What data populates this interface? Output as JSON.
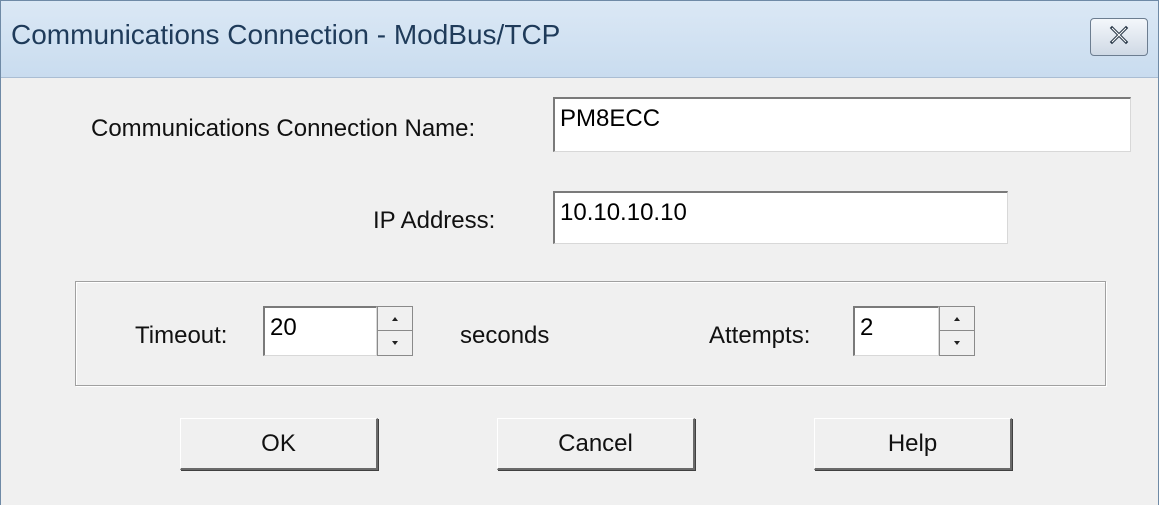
{
  "window": {
    "title": "Communications Connection - ModBus/TCP",
    "close_icon": "close-x-icon"
  },
  "form": {
    "name_label": "Communications Connection Name:",
    "name_value": "PM8ECC",
    "ip_label": "IP Address:",
    "ip_value": "10.10.10.10"
  },
  "settings": {
    "timeout_label": "Timeout:",
    "timeout_value": "20",
    "timeout_unit": "seconds",
    "attempts_label": "Attempts:",
    "attempts_value": "2"
  },
  "buttons": {
    "ok": "OK",
    "cancel": "Cancel",
    "help": "Help"
  }
}
